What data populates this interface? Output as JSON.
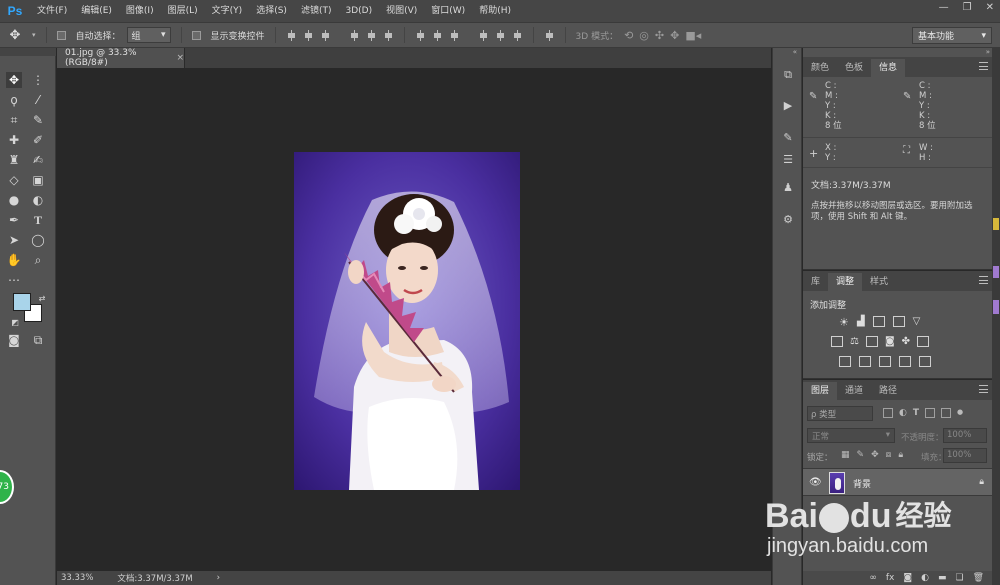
{
  "app": {
    "logo": "Ps"
  },
  "menu": [
    "文件(F)",
    "编辑(E)",
    "图像(I)",
    "图层(L)",
    "文字(Y)",
    "选择(S)",
    "滤镜(T)",
    "3D(D)",
    "视图(V)",
    "窗口(W)",
    "帮助(H)"
  ],
  "window_controls": {
    "minimize": "—",
    "restore": "❐",
    "close": "✕"
  },
  "options": {
    "auto_select_label": "自动选择：",
    "auto_select_value": "组",
    "show_transform_label": "显示变换控件",
    "mode_3d_label": "3D 模式：",
    "workspace": "基本功能"
  },
  "document": {
    "tab_title": "01.jpg @ 33.3%(RGB/8#)",
    "tab_close": "×"
  },
  "status": {
    "zoom": "33.33%",
    "doc_info": "文档:3.37M/3.37M",
    "arrow": "›"
  },
  "panels": {
    "info": {
      "tabs": [
        "颜色",
        "色板",
        "信息"
      ],
      "active_tab": "信息",
      "cmyk_labels": [
        "C :",
        "M :",
        "Y :",
        "K :"
      ],
      "bit_depth": "8 位",
      "xy_labels": [
        "X :",
        "Y :"
      ],
      "wh_labels": [
        "W :",
        "H :"
      ],
      "doc_size": "文档:3.37M/3.37M",
      "hint": "点按并拖移以移动图层或选区。要用附加选项，使用 Shift 和 Alt 键。"
    },
    "adjustments": {
      "tabs": [
        "库",
        "调整",
        "样式"
      ],
      "active_tab": "调整",
      "heading": "添加调整"
    },
    "layers": {
      "tabs": [
        "图层",
        "通道",
        "路径"
      ],
      "active_tab": "图层",
      "filter_label": "ρ 类型",
      "blend_mode": "正常",
      "opacity_label": "不透明度：",
      "opacity_value": "100%",
      "lock_label": "锁定：",
      "fill_label": "填充：",
      "fill_value": "100%",
      "layer_name": "背景"
    }
  },
  "badge": "73",
  "watermark": {
    "brand": "Bai",
    "brand2": "du",
    "cn": "经验",
    "url": "jingyan.baidu.com"
  },
  "colors": {
    "foreground": "#a9d4ea",
    "background": "#ffffff",
    "ps_blue": "#31a8ff",
    "badge_green": "#2fb34a"
  }
}
